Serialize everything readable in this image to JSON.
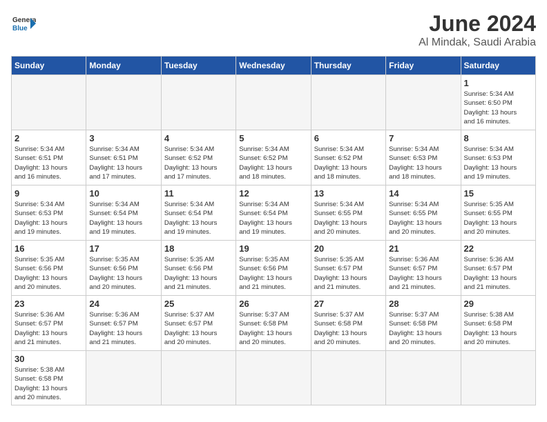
{
  "header": {
    "logo_general": "General",
    "logo_blue": "Blue",
    "month_title": "June 2024",
    "location": "Al Mindak, Saudi Arabia"
  },
  "weekdays": [
    "Sunday",
    "Monday",
    "Tuesday",
    "Wednesday",
    "Thursday",
    "Friday",
    "Saturday"
  ],
  "days": [
    {
      "date": "1",
      "sunrise": "5:34 AM",
      "sunset": "6:50 PM",
      "daylight_hours": "13 hours",
      "daylight_minutes": "16 minutes."
    },
    {
      "date": "2",
      "sunrise": "5:34 AM",
      "sunset": "6:51 PM",
      "daylight_hours": "13 hours",
      "daylight_minutes": "16 minutes."
    },
    {
      "date": "3",
      "sunrise": "5:34 AM",
      "sunset": "6:51 PM",
      "daylight_hours": "13 hours",
      "daylight_minutes": "17 minutes."
    },
    {
      "date": "4",
      "sunrise": "5:34 AM",
      "sunset": "6:52 PM",
      "daylight_hours": "13 hours",
      "daylight_minutes": "17 minutes."
    },
    {
      "date": "5",
      "sunrise": "5:34 AM",
      "sunset": "6:52 PM",
      "daylight_hours": "13 hours",
      "daylight_minutes": "18 minutes."
    },
    {
      "date": "6",
      "sunrise": "5:34 AM",
      "sunset": "6:52 PM",
      "daylight_hours": "13 hours",
      "daylight_minutes": "18 minutes."
    },
    {
      "date": "7",
      "sunrise": "5:34 AM",
      "sunset": "6:53 PM",
      "daylight_hours": "13 hours",
      "daylight_minutes": "18 minutes."
    },
    {
      "date": "8",
      "sunrise": "5:34 AM",
      "sunset": "6:53 PM",
      "daylight_hours": "13 hours",
      "daylight_minutes": "19 minutes."
    },
    {
      "date": "9",
      "sunrise": "5:34 AM",
      "sunset": "6:53 PM",
      "daylight_hours": "13 hours",
      "daylight_minutes": "19 minutes."
    },
    {
      "date": "10",
      "sunrise": "5:34 AM",
      "sunset": "6:54 PM",
      "daylight_hours": "13 hours",
      "daylight_minutes": "19 minutes."
    },
    {
      "date": "11",
      "sunrise": "5:34 AM",
      "sunset": "6:54 PM",
      "daylight_hours": "13 hours",
      "daylight_minutes": "19 minutes."
    },
    {
      "date": "12",
      "sunrise": "5:34 AM",
      "sunset": "6:54 PM",
      "daylight_hours": "13 hours",
      "daylight_minutes": "19 minutes."
    },
    {
      "date": "13",
      "sunrise": "5:34 AM",
      "sunset": "6:55 PM",
      "daylight_hours": "13 hours",
      "daylight_minutes": "20 minutes."
    },
    {
      "date": "14",
      "sunrise": "5:34 AM",
      "sunset": "6:55 PM",
      "daylight_hours": "13 hours",
      "daylight_minutes": "20 minutes."
    },
    {
      "date": "15",
      "sunrise": "5:35 AM",
      "sunset": "6:55 PM",
      "daylight_hours": "13 hours",
      "daylight_minutes": "20 minutes."
    },
    {
      "date": "16",
      "sunrise": "5:35 AM",
      "sunset": "6:56 PM",
      "daylight_hours": "13 hours",
      "daylight_minutes": "20 minutes."
    },
    {
      "date": "17",
      "sunrise": "5:35 AM",
      "sunset": "6:56 PM",
      "daylight_hours": "13 hours",
      "daylight_minutes": "20 minutes."
    },
    {
      "date": "18",
      "sunrise": "5:35 AM",
      "sunset": "6:56 PM",
      "daylight_hours": "13 hours",
      "daylight_minutes": "21 minutes."
    },
    {
      "date": "19",
      "sunrise": "5:35 AM",
      "sunset": "6:56 PM",
      "daylight_hours": "13 hours",
      "daylight_minutes": "21 minutes."
    },
    {
      "date": "20",
      "sunrise": "5:35 AM",
      "sunset": "6:57 PM",
      "daylight_hours": "13 hours",
      "daylight_minutes": "21 minutes."
    },
    {
      "date": "21",
      "sunrise": "5:36 AM",
      "sunset": "6:57 PM",
      "daylight_hours": "13 hours",
      "daylight_minutes": "21 minutes."
    },
    {
      "date": "22",
      "sunrise": "5:36 AM",
      "sunset": "6:57 PM",
      "daylight_hours": "13 hours",
      "daylight_minutes": "21 minutes."
    },
    {
      "date": "23",
      "sunrise": "5:36 AM",
      "sunset": "6:57 PM",
      "daylight_hours": "13 hours",
      "daylight_minutes": "21 minutes."
    },
    {
      "date": "24",
      "sunrise": "5:36 AM",
      "sunset": "6:57 PM",
      "daylight_hours": "13 hours",
      "daylight_minutes": "21 minutes."
    },
    {
      "date": "25",
      "sunrise": "5:37 AM",
      "sunset": "6:57 PM",
      "daylight_hours": "13 hours",
      "daylight_minutes": "20 minutes."
    },
    {
      "date": "26",
      "sunrise": "5:37 AM",
      "sunset": "6:58 PM",
      "daylight_hours": "13 hours",
      "daylight_minutes": "20 minutes."
    },
    {
      "date": "27",
      "sunrise": "5:37 AM",
      "sunset": "6:58 PM",
      "daylight_hours": "13 hours",
      "daylight_minutes": "20 minutes."
    },
    {
      "date": "28",
      "sunrise": "5:37 AM",
      "sunset": "6:58 PM",
      "daylight_hours": "13 hours",
      "daylight_minutes": "20 minutes."
    },
    {
      "date": "29",
      "sunrise": "5:38 AM",
      "sunset": "6:58 PM",
      "daylight_hours": "13 hours",
      "daylight_minutes": "20 minutes."
    },
    {
      "date": "30",
      "sunrise": "5:38 AM",
      "sunset": "6:58 PM",
      "daylight_hours": "13 hours",
      "daylight_minutes": "20 minutes."
    }
  ],
  "labels": {
    "sunrise": "Sunrise:",
    "sunset": "Sunset:",
    "daylight": "Daylight:"
  }
}
